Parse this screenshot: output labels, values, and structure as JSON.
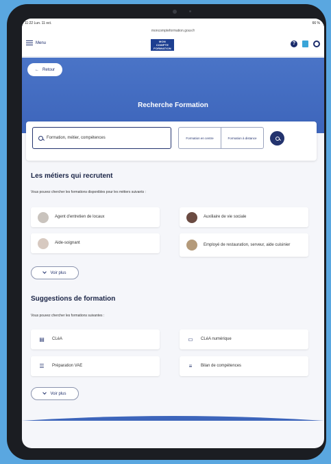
{
  "status_bar": {
    "time": "11:22  Lun. 11 oct.",
    "url": "moncompteformation.gouv.fr",
    "system": "66 %"
  },
  "header": {
    "menu_label": "Menu",
    "logo_lines": [
      "MON",
      "COMPTE",
      "FORMATION"
    ],
    "icons": [
      "help-icon",
      "book-icon",
      "user-icon"
    ]
  },
  "hero": {
    "back_label": "Retour",
    "title": "Recherche Formation",
    "color": "#4a74c7"
  },
  "search": {
    "placeholder": "Formation, métier, compétences",
    "mode_options": [
      "Formation en centre",
      "Formation à distance"
    ]
  },
  "jobs_section": {
    "title": "Les métiers qui recrutent",
    "subtitle": "Vous pouvez chercher les formations disponibles pour les métiers suivants :",
    "items": [
      {
        "label": "Agent d'entretien de locaux",
        "avatar_color": "#c9c3bd"
      },
      {
        "label": "Auxiliaire de vie sociale",
        "avatar_color": "#6b4b42"
      },
      {
        "label": "Aide-soignant",
        "avatar_color": "#d7c9c0"
      },
      {
        "label": "Employé de restauration, serveur, aide cuisinier",
        "avatar_color": "#b49a7a"
      }
    ],
    "more_label": "Voir plus"
  },
  "suggestions_section": {
    "title": "Suggestions de formation",
    "subtitle": "Vous pouvez chercher les formations suivantes :",
    "items": [
      {
        "label": "CLéA",
        "icon": "document-icon",
        "glyph": "▤"
      },
      {
        "label": "CLéA numérique",
        "icon": "monitor-icon",
        "glyph": "▭"
      },
      {
        "label": "Préparation VAE",
        "icon": "list-icon",
        "glyph": "☰"
      },
      {
        "label": "Bilan de compétences",
        "icon": "checklist-icon",
        "glyph": "≡"
      }
    ],
    "more_label": "Voir plus"
  },
  "colors": {
    "primary": "#23336e",
    "page_background": "#5aa7e0",
    "device": "#1b1d22"
  }
}
